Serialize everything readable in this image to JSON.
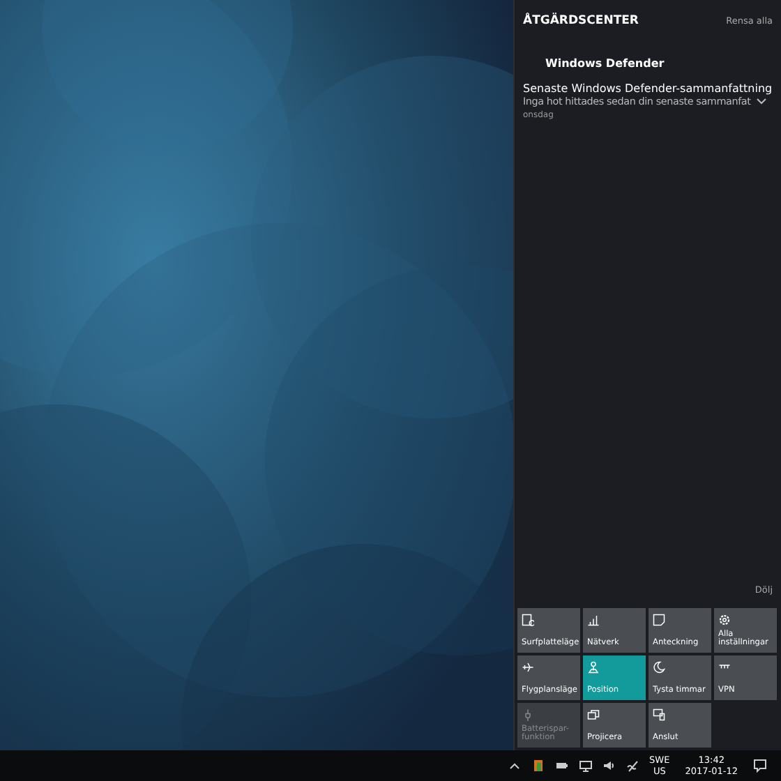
{
  "action_center": {
    "title": "ÅTGÄRDSCENTER",
    "clear_all": "Rensa alla",
    "notification_group": {
      "app": "Windows Defender",
      "notifications": [
        {
          "title": "Senaste Windows Defender-sammanfattning",
          "body": "Inga hot hittades sedan din senaste sammanfat",
          "time": "onsdag",
          "expanded": false
        }
      ]
    },
    "collapse": "Dölj",
    "quick_actions": [
      {
        "kind": "tablet",
        "label": "Surfplatteläge",
        "selected": false,
        "disabled": false
      },
      {
        "kind": "network",
        "label": "Nätverk",
        "selected": false,
        "disabled": false
      },
      {
        "kind": "note",
        "label": "Anteckning",
        "selected": false,
        "disabled": false
      },
      {
        "kind": "settings",
        "label": "Alla inställningar",
        "selected": false,
        "disabled": false
      },
      {
        "kind": "airplane",
        "label": "Flygplansläge",
        "selected": false,
        "disabled": false
      },
      {
        "kind": "location",
        "label": "Position",
        "selected": true,
        "disabled": false
      },
      {
        "kind": "moon",
        "label": "Tysta timmar",
        "selected": false,
        "disabled": false
      },
      {
        "kind": "vpn",
        "label": "VPN",
        "selected": false,
        "disabled": false
      },
      {
        "kind": "battery",
        "label": "Batterispar-funktion",
        "selected": false,
        "disabled": true
      },
      {
        "kind": "project",
        "label": "Projicera",
        "selected": false,
        "disabled": false
      },
      {
        "kind": "connect",
        "label": "Anslut",
        "selected": false,
        "disabled": false
      }
    ]
  },
  "taskbar": {
    "language": "SWE",
    "layout": "US",
    "time": "13:42",
    "date": "2017-01-12"
  }
}
